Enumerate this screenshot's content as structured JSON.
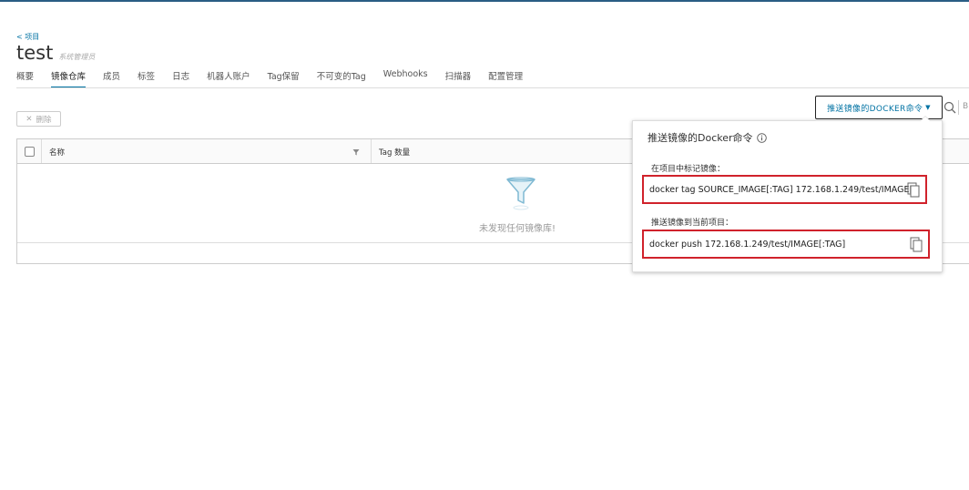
{
  "header": {
    "back_link": "< 项目",
    "title": "test",
    "role": "系统管理员"
  },
  "tabs": [
    {
      "label": "概要"
    },
    {
      "label": "镜像仓库"
    },
    {
      "label": "成员"
    },
    {
      "label": "标签"
    },
    {
      "label": "日志"
    },
    {
      "label": "机器人账户"
    },
    {
      "label": "Tag保留"
    },
    {
      "label": "不可变的Tag"
    },
    {
      "label": "Webhooks"
    },
    {
      "label": "扫描器"
    },
    {
      "label": "配置管理"
    }
  ],
  "active_tab": "镜像仓库",
  "toolbar": {
    "delete_label": "删除",
    "push_button_label": "推送镜像的DOCKER命令",
    "cutoff_text": "B"
  },
  "grid": {
    "columns": [
      "名称",
      "Tag 数量"
    ],
    "empty_text": "未发现任何镜像库!"
  },
  "popover": {
    "title": "推送镜像的Docker命令",
    "tag_label": "在项目中标记镜像：",
    "tag_command": "docker tag SOURCE_IMAGE[:TAG] 172.168.1.249/test/IMAGE[",
    "push_label": "推送镜像到当前项目：",
    "push_command": "docker push 172.168.1.249/test/IMAGE[:TAG]"
  },
  "colors": {
    "accent": "#0072a3",
    "highlight_border": "#d0222b"
  }
}
